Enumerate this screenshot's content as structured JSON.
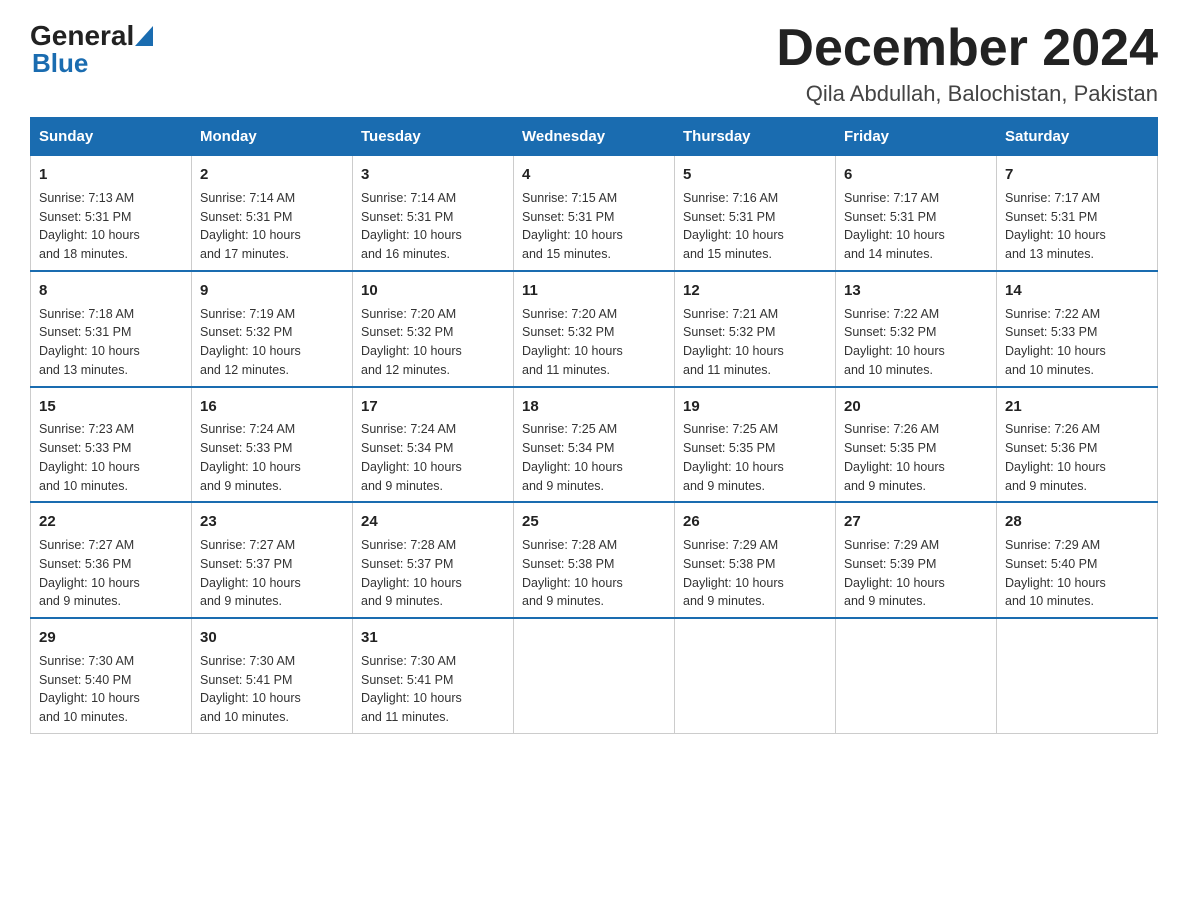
{
  "header": {
    "logo_general": "General",
    "logo_blue": "Blue",
    "month_title": "December 2024",
    "location": "Qila Abdullah, Balochistan, Pakistan"
  },
  "days_of_week": [
    "Sunday",
    "Monday",
    "Tuesday",
    "Wednesday",
    "Thursday",
    "Friday",
    "Saturday"
  ],
  "weeks": [
    {
      "days": [
        {
          "number": "1",
          "sunrise": "7:13 AM",
          "sunset": "5:31 PM",
          "daylight": "10 hours and 18 minutes."
        },
        {
          "number": "2",
          "sunrise": "7:14 AM",
          "sunset": "5:31 PM",
          "daylight": "10 hours and 17 minutes."
        },
        {
          "number": "3",
          "sunrise": "7:14 AM",
          "sunset": "5:31 PM",
          "daylight": "10 hours and 16 minutes."
        },
        {
          "number": "4",
          "sunrise": "7:15 AM",
          "sunset": "5:31 PM",
          "daylight": "10 hours and 15 minutes."
        },
        {
          "number": "5",
          "sunrise": "7:16 AM",
          "sunset": "5:31 PM",
          "daylight": "10 hours and 15 minutes."
        },
        {
          "number": "6",
          "sunrise": "7:17 AM",
          "sunset": "5:31 PM",
          "daylight": "10 hours and 14 minutes."
        },
        {
          "number": "7",
          "sunrise": "7:17 AM",
          "sunset": "5:31 PM",
          "daylight": "10 hours and 13 minutes."
        }
      ]
    },
    {
      "days": [
        {
          "number": "8",
          "sunrise": "7:18 AM",
          "sunset": "5:31 PM",
          "daylight": "10 hours and 13 minutes."
        },
        {
          "number": "9",
          "sunrise": "7:19 AM",
          "sunset": "5:32 PM",
          "daylight": "10 hours and 12 minutes."
        },
        {
          "number": "10",
          "sunrise": "7:20 AM",
          "sunset": "5:32 PM",
          "daylight": "10 hours and 12 minutes."
        },
        {
          "number": "11",
          "sunrise": "7:20 AM",
          "sunset": "5:32 PM",
          "daylight": "10 hours and 11 minutes."
        },
        {
          "number": "12",
          "sunrise": "7:21 AM",
          "sunset": "5:32 PM",
          "daylight": "10 hours and 11 minutes."
        },
        {
          "number": "13",
          "sunrise": "7:22 AM",
          "sunset": "5:32 PM",
          "daylight": "10 hours and 10 minutes."
        },
        {
          "number": "14",
          "sunrise": "7:22 AM",
          "sunset": "5:33 PM",
          "daylight": "10 hours and 10 minutes."
        }
      ]
    },
    {
      "days": [
        {
          "number": "15",
          "sunrise": "7:23 AM",
          "sunset": "5:33 PM",
          "daylight": "10 hours and 10 minutes."
        },
        {
          "number": "16",
          "sunrise": "7:24 AM",
          "sunset": "5:33 PM",
          "daylight": "10 hours and 9 minutes."
        },
        {
          "number": "17",
          "sunrise": "7:24 AM",
          "sunset": "5:34 PM",
          "daylight": "10 hours and 9 minutes."
        },
        {
          "number": "18",
          "sunrise": "7:25 AM",
          "sunset": "5:34 PM",
          "daylight": "10 hours and 9 minutes."
        },
        {
          "number": "19",
          "sunrise": "7:25 AM",
          "sunset": "5:35 PM",
          "daylight": "10 hours and 9 minutes."
        },
        {
          "number": "20",
          "sunrise": "7:26 AM",
          "sunset": "5:35 PM",
          "daylight": "10 hours and 9 minutes."
        },
        {
          "number": "21",
          "sunrise": "7:26 AM",
          "sunset": "5:36 PM",
          "daylight": "10 hours and 9 minutes."
        }
      ]
    },
    {
      "days": [
        {
          "number": "22",
          "sunrise": "7:27 AM",
          "sunset": "5:36 PM",
          "daylight": "10 hours and 9 minutes."
        },
        {
          "number": "23",
          "sunrise": "7:27 AM",
          "sunset": "5:37 PM",
          "daylight": "10 hours and 9 minutes."
        },
        {
          "number": "24",
          "sunrise": "7:28 AM",
          "sunset": "5:37 PM",
          "daylight": "10 hours and 9 minutes."
        },
        {
          "number": "25",
          "sunrise": "7:28 AM",
          "sunset": "5:38 PM",
          "daylight": "10 hours and 9 minutes."
        },
        {
          "number": "26",
          "sunrise": "7:29 AM",
          "sunset": "5:38 PM",
          "daylight": "10 hours and 9 minutes."
        },
        {
          "number": "27",
          "sunrise": "7:29 AM",
          "sunset": "5:39 PM",
          "daylight": "10 hours and 9 minutes."
        },
        {
          "number": "28",
          "sunrise": "7:29 AM",
          "sunset": "5:40 PM",
          "daylight": "10 hours and 10 minutes."
        }
      ]
    },
    {
      "days": [
        {
          "number": "29",
          "sunrise": "7:30 AM",
          "sunset": "5:40 PM",
          "daylight": "10 hours and 10 minutes."
        },
        {
          "number": "30",
          "sunrise": "7:30 AM",
          "sunset": "5:41 PM",
          "daylight": "10 hours and 10 minutes."
        },
        {
          "number": "31",
          "sunrise": "7:30 AM",
          "sunset": "5:41 PM",
          "daylight": "10 hours and 11 minutes."
        },
        null,
        null,
        null,
        null
      ]
    }
  ],
  "labels": {
    "sunrise": "Sunrise:",
    "sunset": "Sunset:",
    "daylight": "Daylight:"
  }
}
